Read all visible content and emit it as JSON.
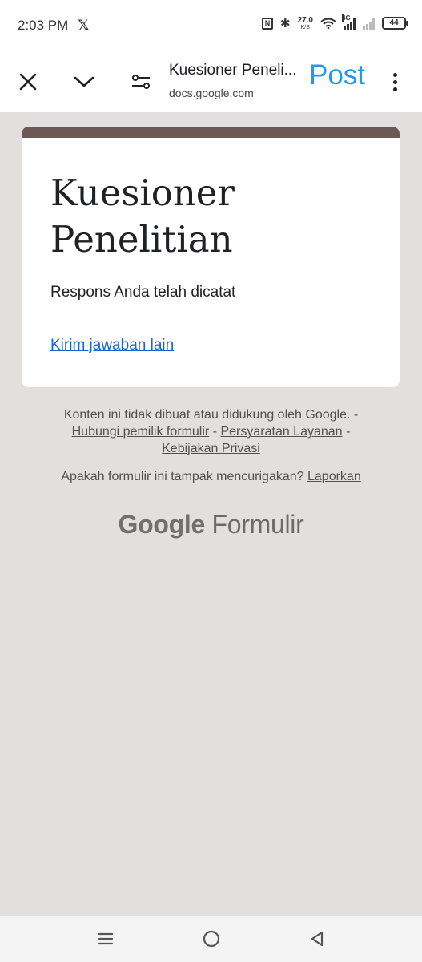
{
  "status_bar": {
    "time": "2:03 PM",
    "x_app": "𝕏",
    "speed_value": "27.0",
    "speed_unit": "K/S",
    "network_label": "4G",
    "battery": "44"
  },
  "toolbar": {
    "page_title": "Kuesioner Peneli...",
    "domain": "docs.google.com",
    "post_label": "Post",
    "post_color": "#1d9bf0"
  },
  "form": {
    "title": "Kuesioner Penelitian",
    "response_message": "Respons Anda telah dicatat",
    "resend_link": "Kirim jawaban lain",
    "accent_color": "#6d5757",
    "link_color": "#1a62d2"
  },
  "footer": {
    "disclaimer_text": "Konten ini tidak dibuat atau didukung oleh Google. -",
    "contact_owner": "Hubungi pemilik formulir",
    "sep1": " - ",
    "terms": "Persyaratan Layanan",
    "sep2": " -",
    "privacy": "Kebijakan Privasi",
    "suspicious_text": "Apakah formulir ini tampak mencurigakan?",
    "report": "Laporkan",
    "logo_google": "Google",
    "logo_product": "Formulir"
  },
  "icons": [
    "close-icon",
    "chevron-down-icon",
    "tune-icon",
    "more-vert-icon",
    "menu-icon",
    "home-icon",
    "back-icon"
  ],
  "background_color": "#e3dfde"
}
